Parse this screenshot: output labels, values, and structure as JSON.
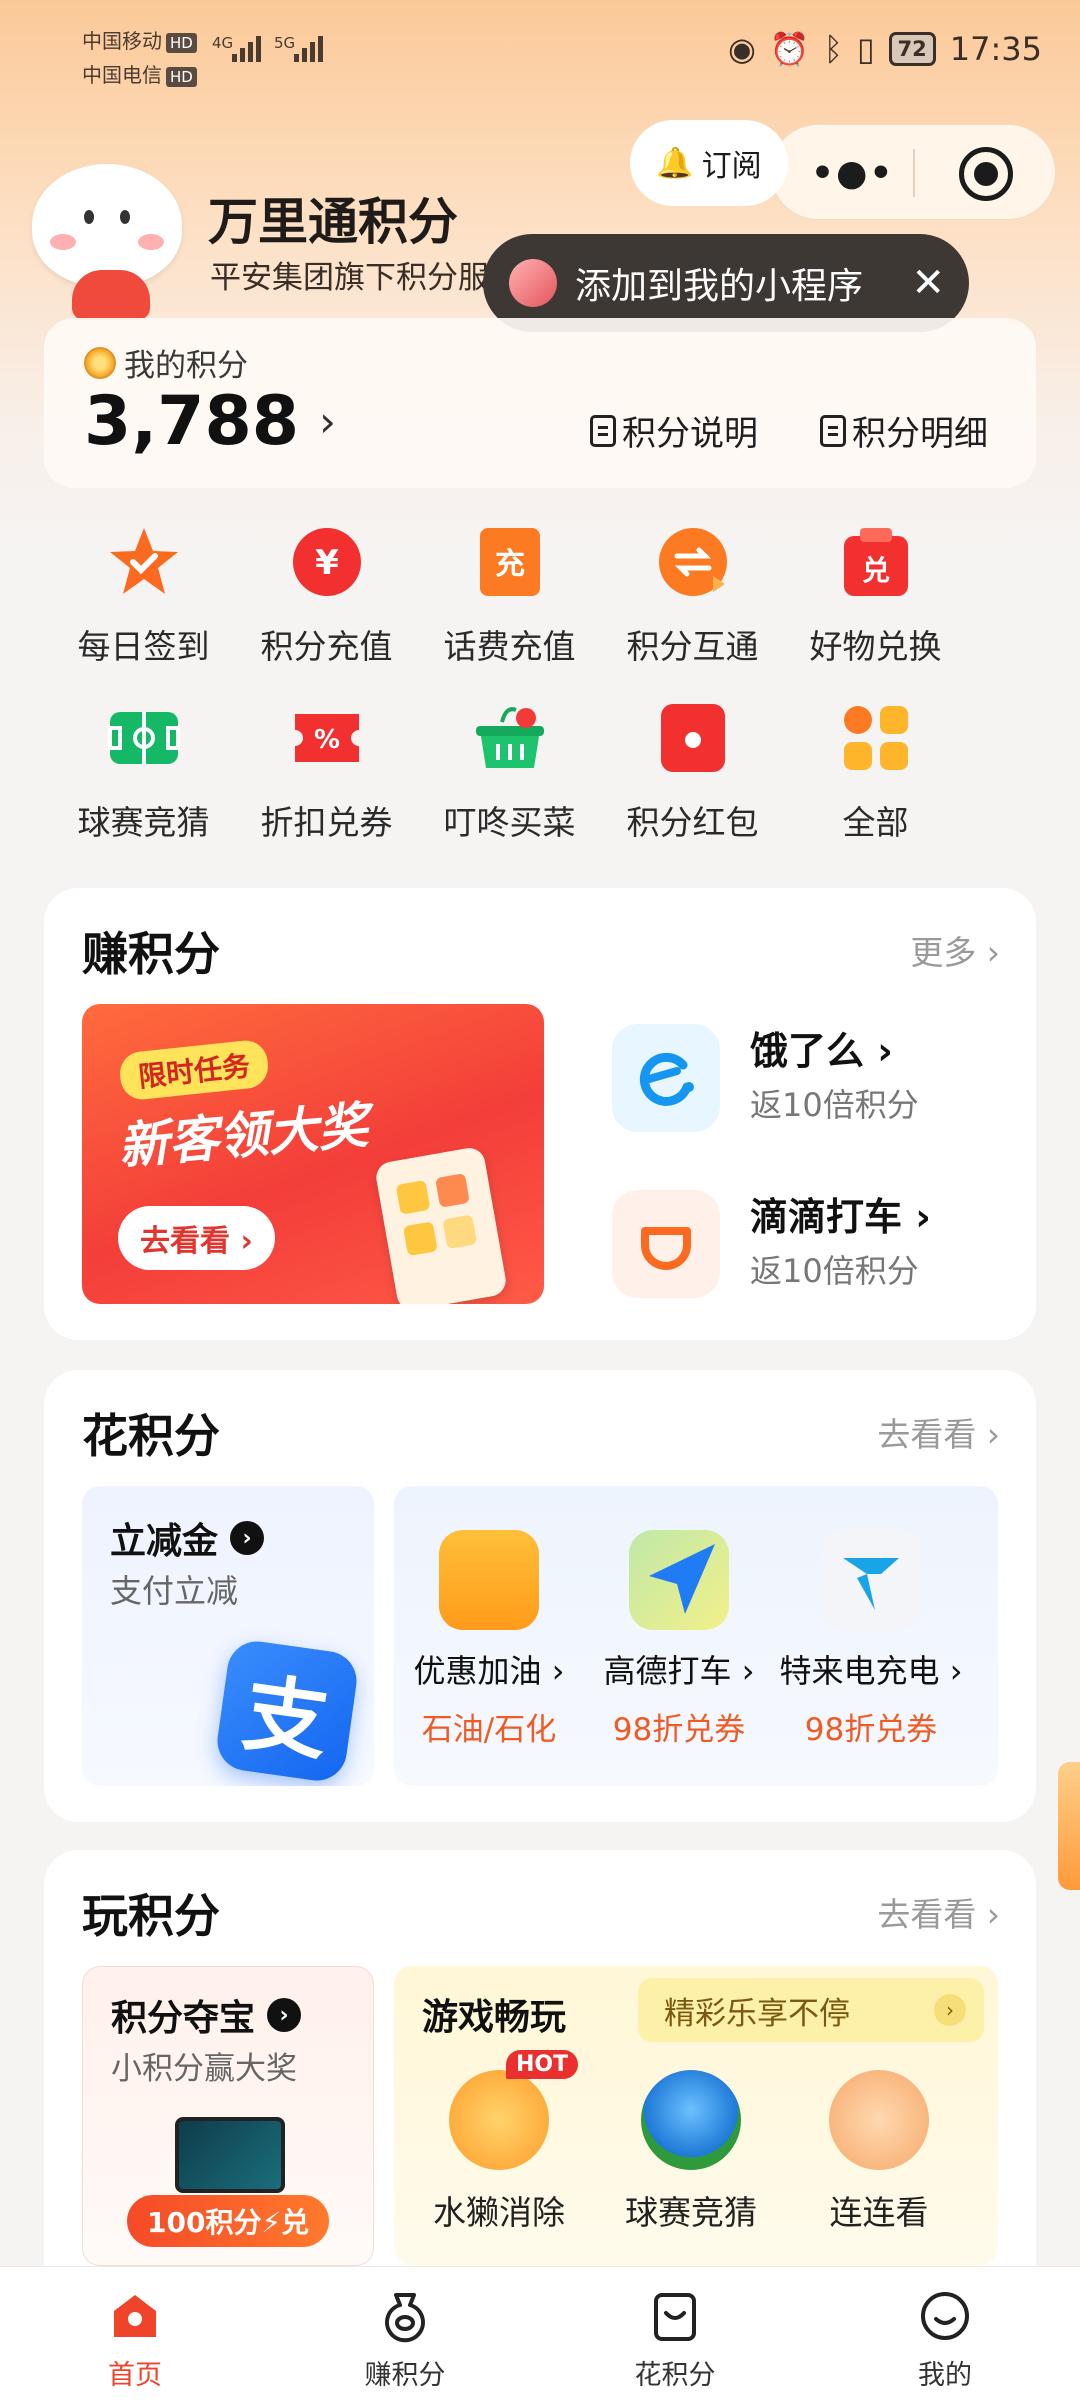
{
  "status_bar": {
    "carrier1": "中国移动",
    "carrier2": "中国电信",
    "hd": "HD",
    "net1": "4G",
    "net2": "5G",
    "battery": "72",
    "time": "17:35"
  },
  "header": {
    "subscribe_label": "订阅",
    "title": "万里通积分",
    "subtitle": "平安集团旗下积分服务平台",
    "toast_text": "添加到我的小程序"
  },
  "points": {
    "label": "我的积分",
    "value": "3,788",
    "explain_label": "积分说明",
    "detail_label": "积分明细"
  },
  "services": [
    {
      "label": "每日签到",
      "icon": "star-check-icon"
    },
    {
      "label": "积分充值",
      "icon": "yen-coin-icon"
    },
    {
      "label": "话费充值",
      "icon": "recharge-icon"
    },
    {
      "label": "积分互通",
      "icon": "exchange-icon"
    },
    {
      "label": "好物兑换",
      "icon": "redeem-bag-icon"
    },
    {
      "label": "球赛竞猜",
      "icon": "soccer-field-icon"
    },
    {
      "label": "折扣兑券",
      "icon": "discount-ticket-icon"
    },
    {
      "label": "叮咚买菜",
      "icon": "grocery-basket-icon"
    },
    {
      "label": "积分红包",
      "icon": "red-packet-icon"
    },
    {
      "label": "全部",
      "icon": "grid-all-icon"
    }
  ],
  "earn": {
    "title": "赚积分",
    "more": "更多",
    "banner_tag": "限时任务",
    "banner_headline": "新客领大奖",
    "banner_cta": "去看看",
    "partners": [
      {
        "name": "饿了么",
        "sub": "返10倍积分"
      },
      {
        "name": "滴滴打车",
        "sub": "返10倍积分"
      }
    ]
  },
  "spend": {
    "title": "花积分",
    "more": "去看看",
    "left_title": "立减金",
    "left_sub": "支付立减",
    "alipay_glyph": "支",
    "items": [
      {
        "name": "优惠加油",
        "sub": "石油/石化"
      },
      {
        "name": "高德打车",
        "sub": "98折兑券"
      },
      {
        "name": "特来电充电",
        "sub": "98折兑券"
      }
    ]
  },
  "play": {
    "title": "玩积分",
    "more": "去看看",
    "left_title": "积分夺宝",
    "left_sub": "小积分赢大奖",
    "left_pill": "100积分⚡兑",
    "right_title": "游戏畅玩",
    "right_banner": "精彩乐享不停",
    "hot_badge": "HOT",
    "games": [
      {
        "name": "水獭消除"
      },
      {
        "name": "球赛竞猜"
      },
      {
        "name": "连连看"
      }
    ]
  },
  "tabbar": [
    {
      "label": "首页",
      "active": true
    },
    {
      "label": "赚积分",
      "active": false
    },
    {
      "label": "花积分",
      "active": false
    },
    {
      "label": "我的",
      "active": false
    }
  ],
  "colors": {
    "accent": "#f0442a",
    "orange_text": "#f05a24"
  }
}
